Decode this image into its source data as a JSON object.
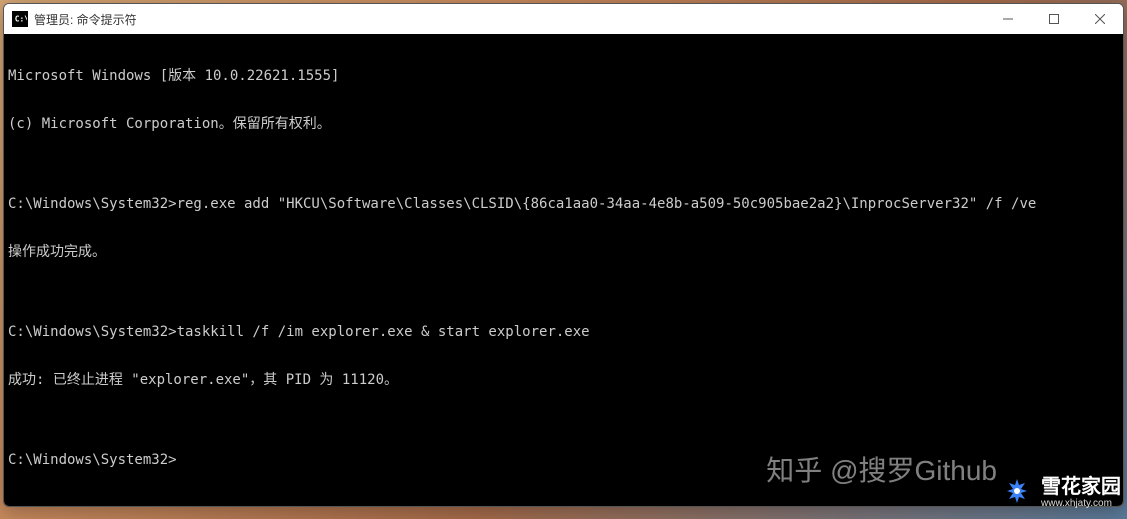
{
  "titlebar": {
    "icon_label": "C:\\",
    "title": "管理员: 命令提示符"
  },
  "terminal": {
    "lines": [
      "Microsoft Windows [版本 10.0.22621.1555]",
      "(c) Microsoft Corporation。保留所有权利。",
      "",
      "C:\\Windows\\System32>reg.exe add \"HKCU\\Software\\Classes\\CLSID\\{86ca1aa0-34aa-4e8b-a509-50c905bae2a2}\\InprocServer32\" /f /ve",
      "操作成功完成。",
      "",
      "C:\\Windows\\System32>taskkill /f /im explorer.exe & start explorer.exe",
      "成功: 已终止进程 \"explorer.exe\"，其 PID 为 11120。",
      "",
      "C:\\Windows\\System32>"
    ]
  },
  "watermarks": {
    "w1": "知乎 @搜罗Github",
    "w2_main": "雪花家园",
    "w2_sub": "www.xhjaty.com"
  }
}
